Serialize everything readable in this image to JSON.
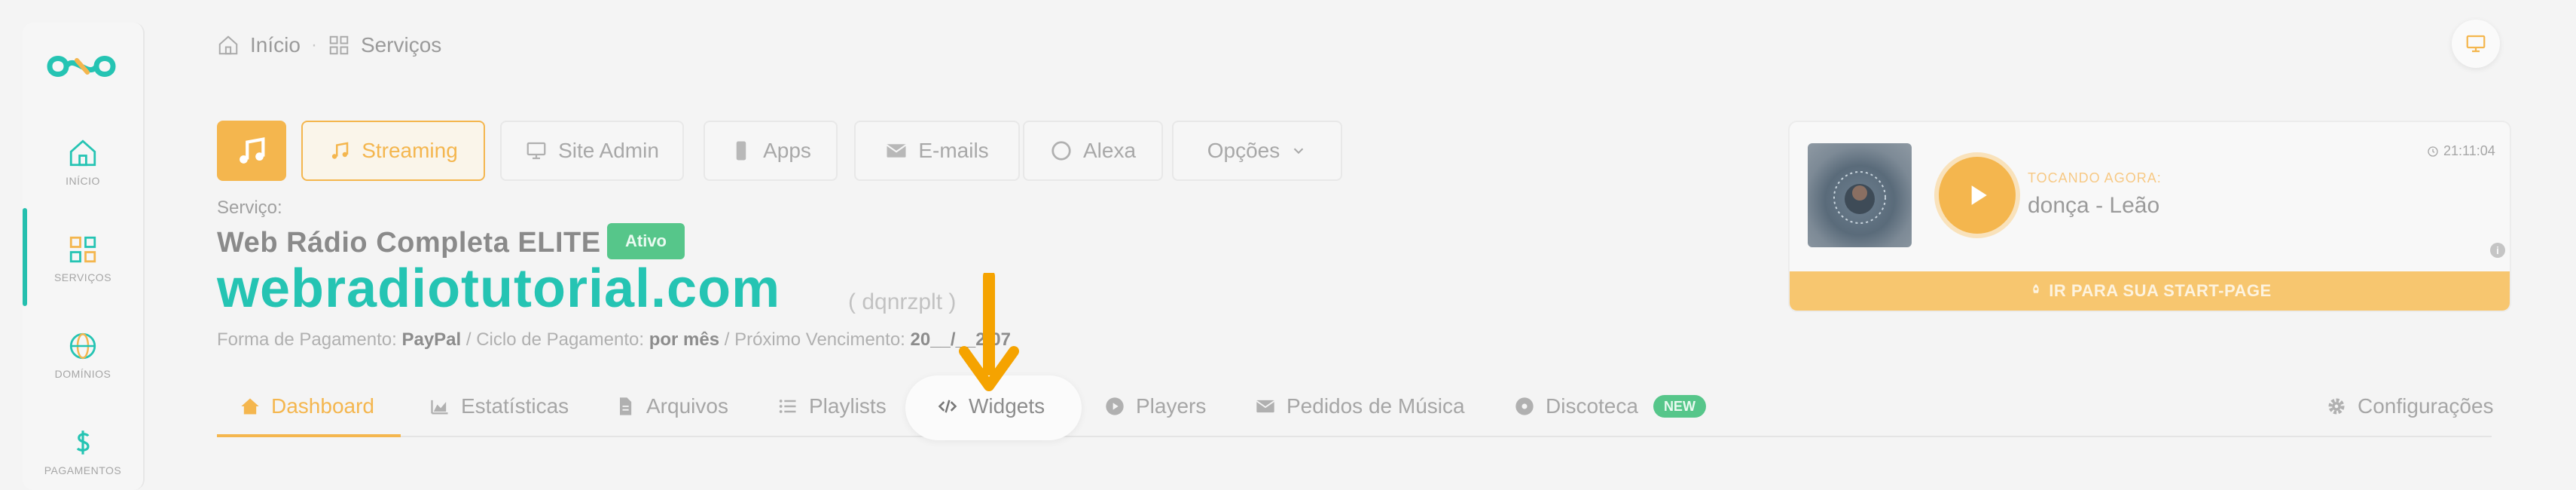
{
  "breadcrumb": {
    "home": "Início",
    "separator": "·",
    "current": "Serviços"
  },
  "sidebar": {
    "items": [
      {
        "label": "INÍCIO",
        "icon": "home-icon"
      },
      {
        "label": "SERVIÇOS",
        "icon": "grid-icon",
        "active": true
      },
      {
        "label": "DOMÍNIOS",
        "icon": "globe-icon"
      },
      {
        "label": "PAGAMENTOS",
        "icon": "dollar-icon"
      }
    ]
  },
  "top_buttons": {
    "streaming": "Streaming",
    "site_admin": "Site Admin",
    "apps": "Apps",
    "emails": "E-mails",
    "alexa": "Alexa",
    "opcoes": "Opções"
  },
  "service": {
    "label": "Serviço:",
    "name": "Web Rádio Completa ELITE",
    "status": "Ativo",
    "domain": "webradiotutorial.com",
    "login": "( dqnrzplt )",
    "payment_label": "Forma de Pagamento:",
    "payment_value": "PayPal",
    "cycle_label": "/ Ciclo de Pagamento:",
    "cycle_value": "por mês",
    "due_label": "/ Próximo Vencimento:",
    "due_value": "20__/__2/07"
  },
  "player": {
    "time": "21:11:04",
    "now_playing_label": "TOCANDO AGORA:",
    "song": "donça - Leão",
    "start_page_button": "IR PARA SUA START-PAGE"
  },
  "tabs": {
    "dashboard": "Dashboard",
    "estatisticas": "Estatísticas",
    "arquivos": "Arquivos",
    "playlists": "Playlists",
    "widgets": "Widgets",
    "players": "Players",
    "pedidos": "Pedidos de Música",
    "discoteca": "Discoteca",
    "discoteca_badge": "NEW",
    "configuracoes": "Configurações"
  },
  "colors": {
    "accent_teal": "#25c4b3",
    "accent_orange": "#f4b64e",
    "status_green": "#56c68a",
    "arrow_orange": "#f5a300"
  }
}
